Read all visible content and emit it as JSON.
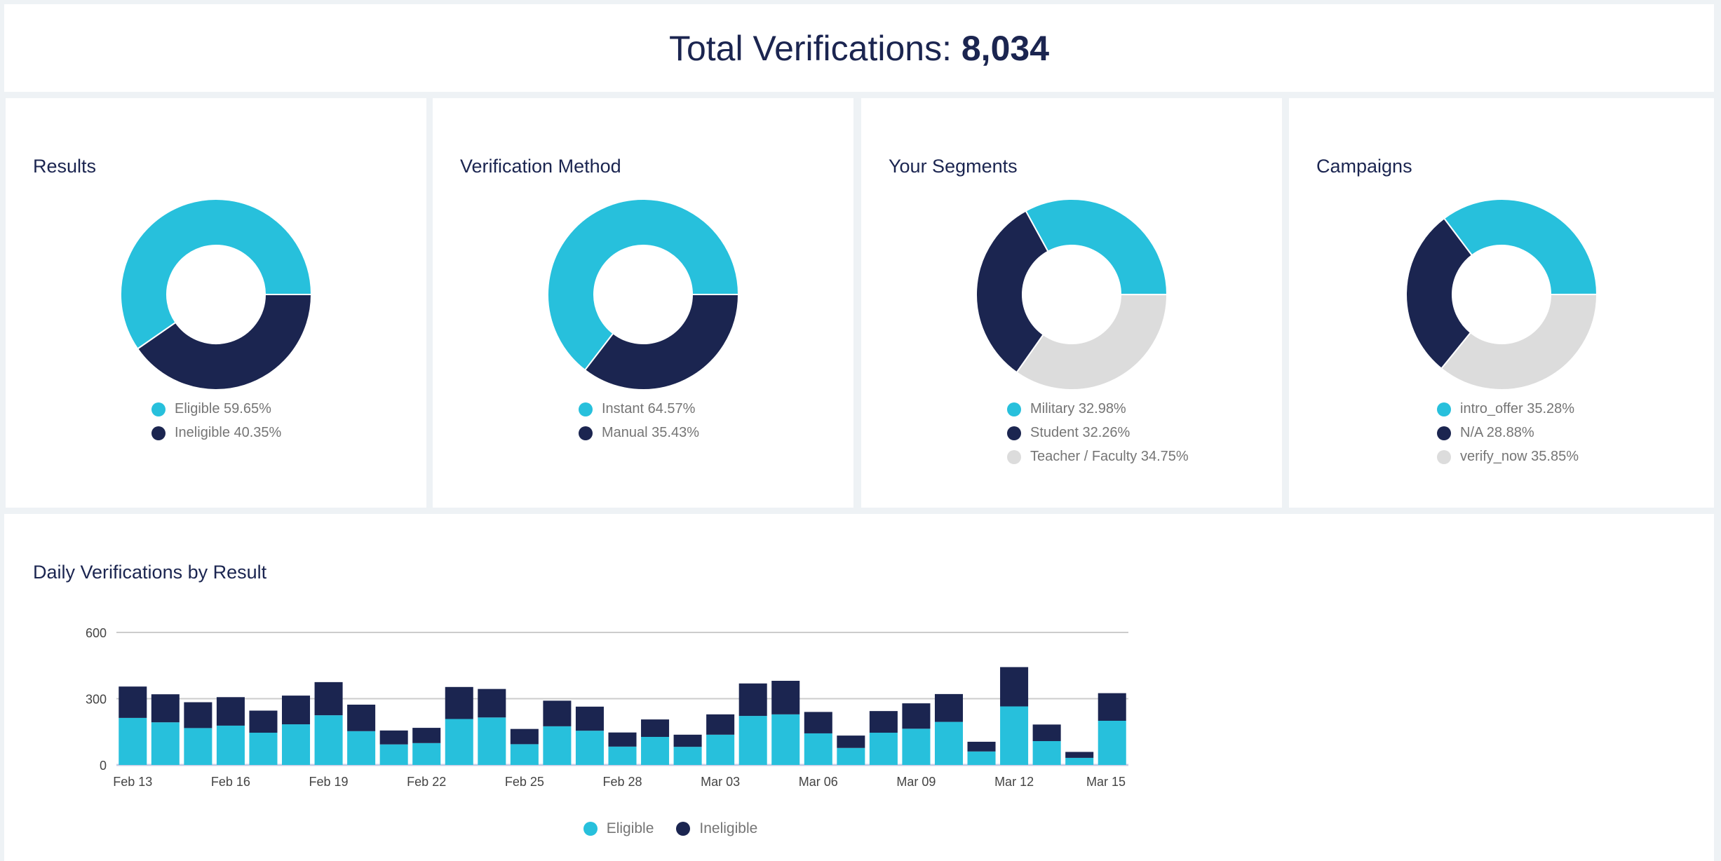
{
  "header": {
    "label": "Total Verifications:",
    "value": "8,034"
  },
  "colors": {
    "cyan": "#27c0dc",
    "navy": "#1b2550",
    "grey": "#dcdcdc"
  },
  "donuts": [
    {
      "title": "Results",
      "slices": [
        {
          "label": "Eligible 59.65%",
          "value": 59.65,
          "color": "#27c0dc"
        },
        {
          "label": "Ineligible 40.35%",
          "value": 40.35,
          "color": "#1b2550"
        }
      ]
    },
    {
      "title": "Verification Method",
      "slices": [
        {
          "label": "Instant 64.57%",
          "value": 64.57,
          "color": "#27c0dc"
        },
        {
          "label": "Manual 35.43%",
          "value": 35.43,
          "color": "#1b2550"
        }
      ]
    },
    {
      "title": "Your Segments",
      "slices": [
        {
          "label": "Military 32.98%",
          "value": 32.98,
          "color": "#27c0dc"
        },
        {
          "label": "Student 32.26%",
          "value": 32.26,
          "color": "#1b2550"
        },
        {
          "label": "Teacher / Faculty 34.75%",
          "value": 34.75,
          "color": "#dcdcdc"
        }
      ]
    },
    {
      "title": "Campaigns",
      "slices": [
        {
          "label": "intro_offer 35.28%",
          "value": 35.28,
          "color": "#27c0dc"
        },
        {
          "label": "N/A 28.88%",
          "value": 28.88,
          "color": "#1b2550"
        },
        {
          "label": "verify_now 35.85%",
          "value": 35.85,
          "color": "#dcdcdc"
        }
      ]
    }
  ],
  "chart_data": {
    "type": "bar",
    "stacked": true,
    "title": "Daily Verifications by Result",
    "ylim": [
      0,
      600
    ],
    "y_ticks": [
      "0",
      "300",
      "600"
    ],
    "grid": true,
    "legend_position": "bottom",
    "x_tick_labels": [
      {
        "index": 0,
        "label": "Feb 13"
      },
      {
        "index": 3,
        "label": "Feb 16"
      },
      {
        "index": 6,
        "label": "Feb 19"
      },
      {
        "index": 9,
        "label": "Feb 22"
      },
      {
        "index": 12,
        "label": "Feb 25"
      },
      {
        "index": 15,
        "label": "Feb 28"
      },
      {
        "index": 18,
        "label": "Mar 03"
      },
      {
        "index": 21,
        "label": "Mar 06"
      },
      {
        "index": 24,
        "label": "Mar 09"
      },
      {
        "index": 27,
        "label": "Mar 12"
      },
      {
        "index": 30,
        "label": "Mar 15"
      }
    ],
    "series": [
      {
        "name": "Eligible",
        "color": "#27c0dc",
        "values": [
          213,
          193,
          167,
          178,
          146,
          184,
          225,
          153,
          93,
          99,
          208,
          215,
          94,
          175,
          155,
          83,
          127,
          82,
          137,
          222,
          229,
          143,
          77,
          146,
          164,
          195,
          61,
          265,
          108,
          32,
          200
        ]
      },
      {
        "name": "Ineligible",
        "color": "#1b2550",
        "values": [
          142,
          127,
          117,
          129,
          100,
          130,
          150,
          120,
          63,
          69,
          145,
          129,
          69,
          116,
          109,
          64,
          79,
          55,
          92,
          147,
          152,
          97,
          56,
          98,
          115,
          126,
          44,
          178,
          75,
          27,
          125
        ]
      }
    ]
  }
}
